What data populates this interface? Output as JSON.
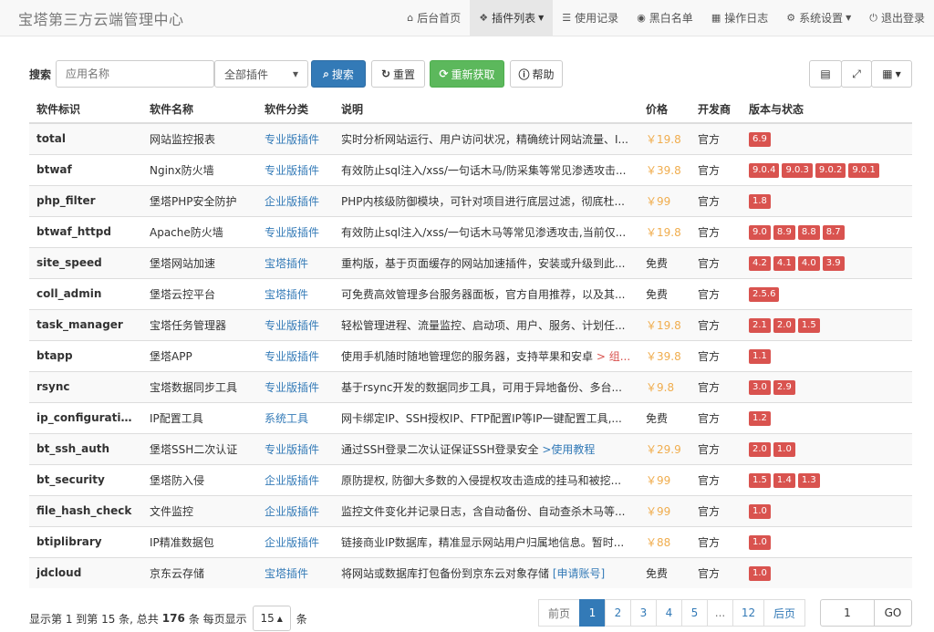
{
  "brand": "宝塔第三方云端管理中心",
  "nav": [
    {
      "icon": "home-icon",
      "glyph": "⌂",
      "label": "后台首页"
    },
    {
      "icon": "cubes-icon",
      "glyph": "❖",
      "label": "插件列表",
      "active": true
    },
    {
      "icon": "list-icon",
      "glyph": "☰",
      "label": "使用记录"
    },
    {
      "icon": "ban-icon",
      "glyph": "◉",
      "label": "黑白名单"
    },
    {
      "icon": "calendar-icon",
      "glyph": "▦",
      "label": "操作日志"
    },
    {
      "icon": "gear-icon",
      "glyph": "⚙",
      "label": "系统设置"
    },
    {
      "icon": "power-icon",
      "glyph": "⏻",
      "label": "退出登录"
    }
  ],
  "toolbar": {
    "search_label": "搜索",
    "search_placeholder": "应用名称",
    "filter_value": "全部插件",
    "search_btn": "搜索",
    "reset_btn": "重置",
    "refetch_btn": "重新获取",
    "help_btn": "帮助"
  },
  "table": {
    "headers": [
      "软件标识",
      "软件名称",
      "软件分类",
      "说明",
      "价格",
      "开发商",
      "版本与状态"
    ],
    "rows": [
      {
        "id": "total",
        "name": "网站监控报表",
        "cat": "专业版插件",
        "desc": "实时分析网站运行、用户访问状况，精确统计网站流量、I...",
        "price": "￥19.8",
        "dev": "官方",
        "vers": [
          "6.9"
        ]
      },
      {
        "id": "btwaf",
        "name": "Nginx防火墙",
        "cat": "专业版插件",
        "desc": "有效防止sql注入/xss/一句话木马/防采集等常见渗透攻击...",
        "price": "￥39.8",
        "dev": "官方",
        "vers": [
          "9.0.4",
          "9.0.3",
          "9.0.2",
          "9.0.1"
        ]
      },
      {
        "id": "php_filter",
        "name": "堡塔PHP安全防护",
        "cat": "企业版插件",
        "desc": "PHP内核级防御模块，可针对项目进行底层过滤，彻底杜...",
        "price": "￥99",
        "dev": "官方",
        "vers": [
          "1.8"
        ]
      },
      {
        "id": "btwaf_httpd",
        "name": "Apache防火墙",
        "cat": "专业版插件",
        "desc": "有效防止sql注入/xss/一句话木马等常见渗透攻击,当前仅...",
        "price": "￥19.8",
        "dev": "官方",
        "vers": [
          "9.0",
          "8.9",
          "8.8",
          "8.7"
        ]
      },
      {
        "id": "site_speed",
        "name": "堡塔网站加速",
        "cat": "宝塔插件",
        "desc": "重构版，基于页面缓存的网站加速插件，安装或升级到此...",
        "price": "免费",
        "dev": "官方",
        "vers": [
          "4.2",
          "4.1",
          "4.0",
          "3.9"
        ]
      },
      {
        "id": "coll_admin",
        "name": "堡塔云控平台",
        "cat": "宝塔插件",
        "desc": "可免费高效管理多台服务器面板，官方自用推荐，以及其...",
        "price": "免费",
        "dev": "官方",
        "vers": [
          "2.5.6"
        ]
      },
      {
        "id": "task_manager",
        "name": "宝塔任务管理器",
        "cat": "专业版插件",
        "desc": "轻松管理进程、流量监控、启动项、用户、服务、计划任...",
        "price": "￥19.8",
        "dev": "官方",
        "vers": [
          "2.1",
          "2.0",
          "1.5"
        ]
      },
      {
        "id": "btapp",
        "name": "堡塔APP",
        "cat": "专业版插件",
        "desc": "使用手机随时随地管理您的服务器，支持苹果和安卓",
        "desc_link": " > 组...",
        "price": "￥39.8",
        "dev": "官方",
        "vers": [
          "1.1"
        ]
      },
      {
        "id": "rsync",
        "name": "宝塔数据同步工具",
        "cat": "专业版插件",
        "desc": "基于rsync开发的数据同步工具，可用于异地备份、多台...",
        "price": "￥9.8",
        "dev": "官方",
        "vers": [
          "3.0",
          "2.9"
        ]
      },
      {
        "id": "ip_configuration",
        "name": "IP配置工具",
        "cat": "系统工具",
        "desc": "网卡绑定IP、SSH授权IP、FTP配置IP等IP一键配置工具,...",
        "price": "免费",
        "dev": "官方",
        "vers": [
          "1.2"
        ]
      },
      {
        "id": "bt_ssh_auth",
        "name": "堡塔SSH二次认证",
        "cat": "专业版插件",
        "desc": "通过SSH登录二次认证保证SSH登录安全",
        "desc_link": " >使用教程",
        "price": "￥29.9",
        "dev": "官方",
        "vers": [
          "2.0",
          "1.0"
        ]
      },
      {
        "id": "bt_security",
        "name": "堡塔防入侵",
        "cat": "企业版插件",
        "desc": "原防提权, 防御大多数的入侵提权攻击造成的挂马和被挖...",
        "price": "￥99",
        "dev": "官方",
        "vers": [
          "1.5",
          "1.4",
          "1.3"
        ]
      },
      {
        "id": "file_hash_check",
        "name": "文件监控",
        "cat": "企业版插件",
        "desc": "监控文件变化并记录日志，含自动备份、自动查杀木马等...",
        "price": "￥99",
        "dev": "官方",
        "vers": [
          "1.0"
        ]
      },
      {
        "id": "btiplibrary",
        "name": "IP精准数据包",
        "cat": "企业版插件",
        "desc": "链接商业IP数据库，精准显示网站用户归属地信息。暂时...",
        "price": "￥88",
        "dev": "官方",
        "vers": [
          "1.0"
        ]
      },
      {
        "id": "jdcloud",
        "name": "京东云存储",
        "cat": "宝塔插件",
        "desc": "将网站或数据库打包备份到京东云对象存储",
        "desc_link": " [申请账号]",
        "price": "免费",
        "dev": "官方",
        "vers": [
          "1.0"
        ]
      }
    ]
  },
  "footer": {
    "info_prefix": "显示第 1 到第 15 条, 总共",
    "total": "176",
    "info_mid": "条  每页显示",
    "pagesize": "15",
    "info_suffix": "条"
  },
  "pagination": {
    "prev": "前页",
    "pages": [
      "1",
      "2",
      "3",
      "4",
      "5",
      "...",
      "12"
    ],
    "next": "后页",
    "goto_value": "1",
    "goto_btn": "GO"
  }
}
